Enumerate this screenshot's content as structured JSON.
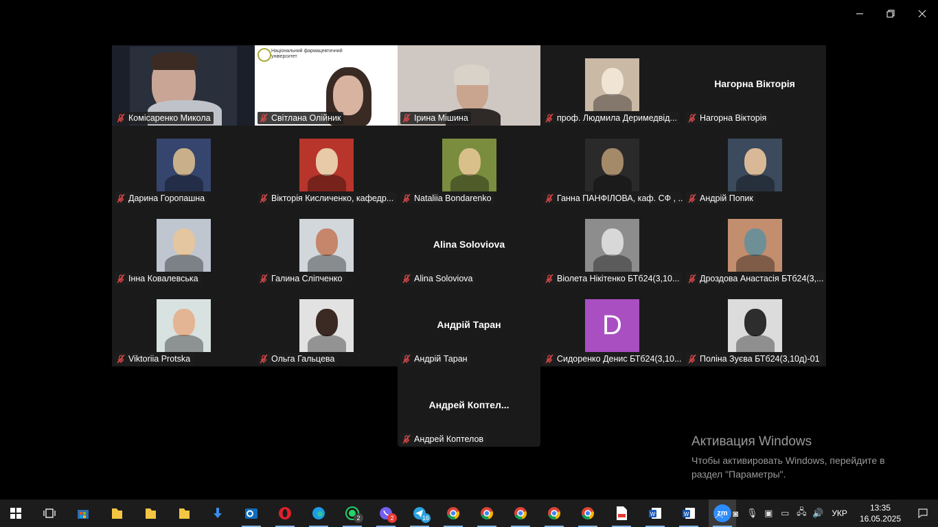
{
  "window_controls": {
    "minimize": "minimize",
    "restore": "restore",
    "close": "close"
  },
  "participants": [
    {
      "name": "Комісаренко Микола",
      "kind": "video",
      "active": true
    },
    {
      "name": "Світлана Олійник",
      "kind": "video",
      "slide_line1": "Національний фармацевтичний",
      "slide_line2": "університет"
    },
    {
      "name": "Ірина Мішина",
      "kind": "video"
    },
    {
      "name": "проф. Людмила Деримедвід...",
      "kind": "photo"
    },
    {
      "name": "Нагорна Вікторія",
      "kind": "bigname",
      "big": "Нагорна Вікторія"
    },
    {
      "name": "Дарина Горопашна",
      "kind": "photo"
    },
    {
      "name": "Вікторія Кисличенко, кафедр...",
      "kind": "photo"
    },
    {
      "name": "Nataliia Bondarenko",
      "kind": "photo"
    },
    {
      "name": "Ганна ПАНФІЛОВА, каф. СФ , ...",
      "kind": "photo"
    },
    {
      "name": "Андрій Попик",
      "kind": "photo"
    },
    {
      "name": "Інна Ковалевська",
      "kind": "photo"
    },
    {
      "name": "Галина Сліпченко",
      "kind": "photo"
    },
    {
      "name": "Alina Soloviova",
      "kind": "bigname",
      "big": "Alina Soloviova"
    },
    {
      "name": "Віолета Нікітенко БТб24(3,10...",
      "kind": "photo"
    },
    {
      "name": "Дроздова Анастасія БТб24(3,...",
      "kind": "photo"
    },
    {
      "name": "Viktoriia Protska",
      "kind": "photo"
    },
    {
      "name": "Ольга Гальцева",
      "kind": "photo"
    },
    {
      "name": "Андрій Таран",
      "kind": "bigname",
      "big": "Андрій Таран"
    },
    {
      "name": "Сидоренко Денис БТб24(3,10...",
      "kind": "letter",
      "letter": "D"
    },
    {
      "name": "Поліна Зуєва БТб24(3,10д)-01",
      "kind": "photo"
    },
    {
      "name": "Андрей Коптелов",
      "kind": "bigname",
      "big": "Андрей  Коптел..."
    }
  ],
  "activation": {
    "title": "Активация Windows",
    "line1": "Чтобы активировать Windows, перейдите в",
    "line2": "раздел \"Параметры\"."
  },
  "taskbar": {
    "apps": [
      {
        "name": "start-icon"
      },
      {
        "name": "task-view-icon"
      },
      {
        "name": "store-icon"
      },
      {
        "name": "folder-icon"
      },
      {
        "name": "folder-icon"
      },
      {
        "name": "folder-icon"
      },
      {
        "name": "download-icon"
      },
      {
        "name": "outlook-icon"
      },
      {
        "name": "opera-icon"
      },
      {
        "name": "edge-icon"
      },
      {
        "name": "whatsapp-icon",
        "badge": "2"
      },
      {
        "name": "viber-icon",
        "badge": "2"
      },
      {
        "name": "telegram-icon",
        "badge": "16"
      },
      {
        "name": "chrome-icon"
      },
      {
        "name": "chrome-icon"
      },
      {
        "name": "chrome-icon"
      },
      {
        "name": "chrome-icon"
      },
      {
        "name": "chrome-icon"
      },
      {
        "name": "pdf-icon"
      },
      {
        "name": "word-icon"
      },
      {
        "name": "word-icon"
      },
      {
        "name": "zoom-icon",
        "label": "zm"
      }
    ],
    "lang": "УКР",
    "time": "13:35",
    "date": "16.05.2025"
  },
  "colors": {
    "active_speaker": "#2dd36f",
    "muted_mic": "#e04848",
    "letter_avatar": "#a94fc2"
  }
}
